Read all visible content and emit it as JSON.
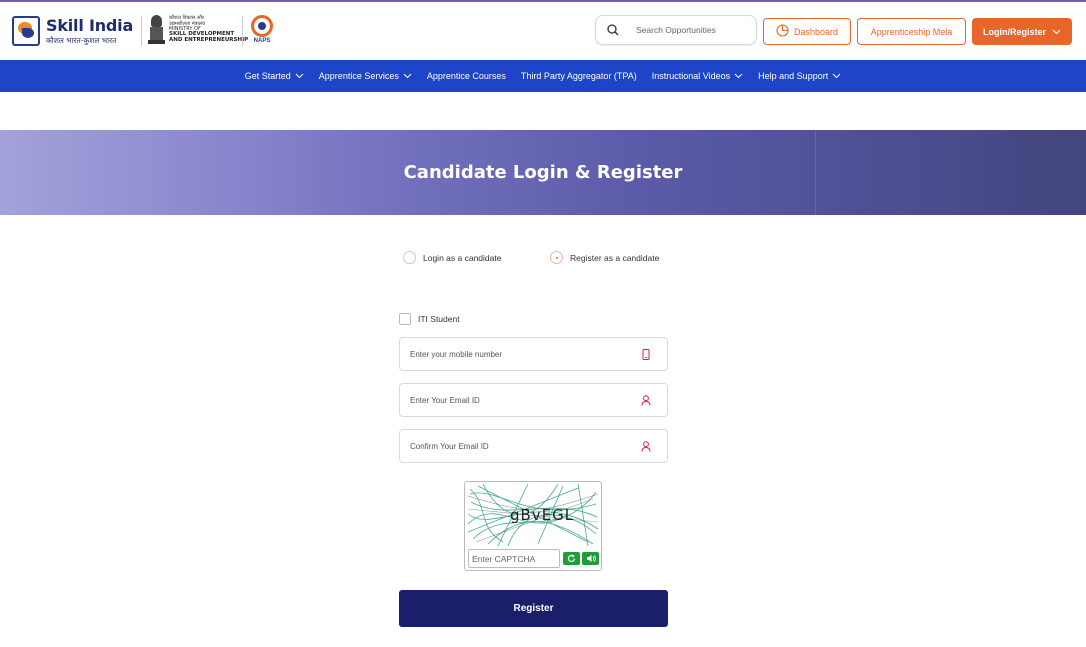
{
  "header": {
    "skill_india": {
      "title": "Skill India",
      "subtitle": "कौशल भारत-कुशल भारत"
    },
    "ministry": {
      "hindi_lines": [
        "कौशल विकास और",
        "उद्यमशीलता मंत्रालय",
        "MINISTRY OF"
      ],
      "english_lines": [
        "SKILL DEVELOPMENT",
        "AND ENTREPRENEURSHIP"
      ]
    },
    "naps": {
      "label": "NAPS"
    },
    "search": {
      "placeholder": "Search Opportunities",
      "value": ""
    },
    "dashboard_label": "Dashboard",
    "mela_label": "Apprenticeship Mela",
    "login_label": "Login/Register",
    "accent_color": "#e8662a"
  },
  "nav": {
    "items": [
      {
        "label": "Get Started",
        "has_dropdown": true
      },
      {
        "label": "Apprentice Services",
        "has_dropdown": true
      },
      {
        "label": "Apprentice Courses",
        "has_dropdown": false
      },
      {
        "label": "Third Party Aggregator (TPA)",
        "has_dropdown": false
      },
      {
        "label": "Instructional Videos",
        "has_dropdown": true
      },
      {
        "label": "Help and Support",
        "has_dropdown": true
      }
    ],
    "bg_color": "#1e44c8"
  },
  "banner": {
    "title": "Candidate Login & Register"
  },
  "form": {
    "mode_options": [
      {
        "label": "Login as a candidate",
        "selected": false
      },
      {
        "label": "Register as a candidate",
        "selected": true
      }
    ],
    "iti_student": {
      "label": "ITI Student",
      "checked": false
    },
    "mobile": {
      "placeholder": "Enter your mobile number",
      "value": "",
      "icon": "mobile-icon"
    },
    "email": {
      "placeholder": "Enter Your Email ID",
      "value": "",
      "icon": "user-icon"
    },
    "confirm_email": {
      "placeholder": "Confirm Your Email ID",
      "value": "",
      "icon": "user-icon"
    },
    "captcha": {
      "text": "gBvEGL",
      "input_placeholder": "Enter CAPTCHA",
      "input_value": ""
    },
    "submit_label": "Register",
    "submit_color": "#1b1f6b"
  }
}
